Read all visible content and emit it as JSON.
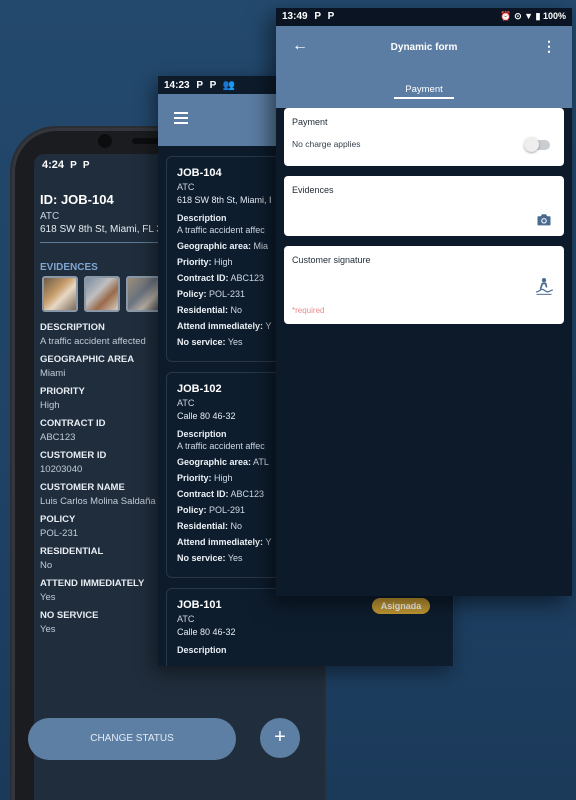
{
  "back_phone": {
    "status_time": "4:24",
    "status_icons": [
      "P",
      "P"
    ],
    "job_title": "ID: JOB-104",
    "job_type": "ATC",
    "job_address": "618 SW 8th St, Miami, FL 3",
    "evidences_label": "EVIDENCES",
    "fields": [
      {
        "label": "DESCRIPTION",
        "value": "A traffic accident affected"
      },
      {
        "label": "GEOGRAPHIC AREA",
        "value": "Miami"
      },
      {
        "label": "PRIORITY",
        "value": "High"
      },
      {
        "label": "CONTRACT ID",
        "value": "ABC123"
      },
      {
        "label": "CUSTOMER ID",
        "value": "10203040"
      },
      {
        "label": "CUSTOMER NAME",
        "value": "Luis Carlos Molina Saldaña"
      },
      {
        "label": "POLICY",
        "value": "POL-231"
      },
      {
        "label": "RESIDENTIAL",
        "value": "No"
      },
      {
        "label": "ATTEND IMMEDIATELY",
        "value": "Yes"
      },
      {
        "label": "NO SERVICE",
        "value": "Yes"
      }
    ],
    "change_status_label": "CHANGE STATUS",
    "fab_label": "+"
  },
  "job_list": {
    "status_time": "14:23",
    "status_icons": [
      "P",
      "P",
      "👥"
    ],
    "jobs": [
      {
        "id": "JOB-104",
        "type": "ATC",
        "address": "618 SW 8th St, Miami, I",
        "description_label": "Description",
        "description": "A traffic accident affec",
        "rows": [
          {
            "label": "Geographic area:",
            "value": "Mia"
          },
          {
            "label": "Priority:",
            "value": "High"
          },
          {
            "label": "Contract ID:",
            "value": "ABC123"
          },
          {
            "label": "Policy:",
            "value": "POL-231"
          },
          {
            "label": "Residential:",
            "value": "No"
          },
          {
            "label": "Attend immediately:",
            "value": "Y"
          },
          {
            "label": "No service:",
            "value": "Yes"
          }
        ]
      },
      {
        "id": "JOB-102",
        "type": "ATC",
        "address": "Calle 80 46-32",
        "description_label": "Description",
        "description": "A traffic accident affec",
        "rows": [
          {
            "label": "Geographic area:",
            "value": "ATL"
          },
          {
            "label": "Priority:",
            "value": "High"
          },
          {
            "label": "Contract ID:",
            "value": "ABC123"
          },
          {
            "label": "Policy:",
            "value": "POL-291"
          },
          {
            "label": "Residential:",
            "value": "No"
          },
          {
            "label": "Attend immediately:",
            "value": "Y"
          },
          {
            "label": "No service:",
            "value": "Yes"
          }
        ]
      },
      {
        "id": "JOB-101",
        "type": "ATC",
        "address": "Calle 80 46-32",
        "description_label": "Description",
        "badge": "Asignada"
      }
    ]
  },
  "dynamic_form": {
    "status_time": "13:49",
    "status_icons": [
      "P",
      "P"
    ],
    "status_right": "⏰ ⊙ ▼ ▮ 100%",
    "back_icon": "←",
    "title": "Dynamic form",
    "more_icon": "⋮",
    "tab": "Payment",
    "cards": [
      {
        "label": "Payment",
        "text": "No charge applies"
      },
      {
        "label": "Evidences"
      },
      {
        "label": "Customer signature",
        "required": "*required"
      }
    ]
  },
  "colors": {
    "background": "#23496d",
    "app_bar": "#5b7da3",
    "screen_dark": "#0c1a2a",
    "badge": "#c49a33",
    "accent_label": "#7fa6d1",
    "required_text": "#e98a8a"
  }
}
